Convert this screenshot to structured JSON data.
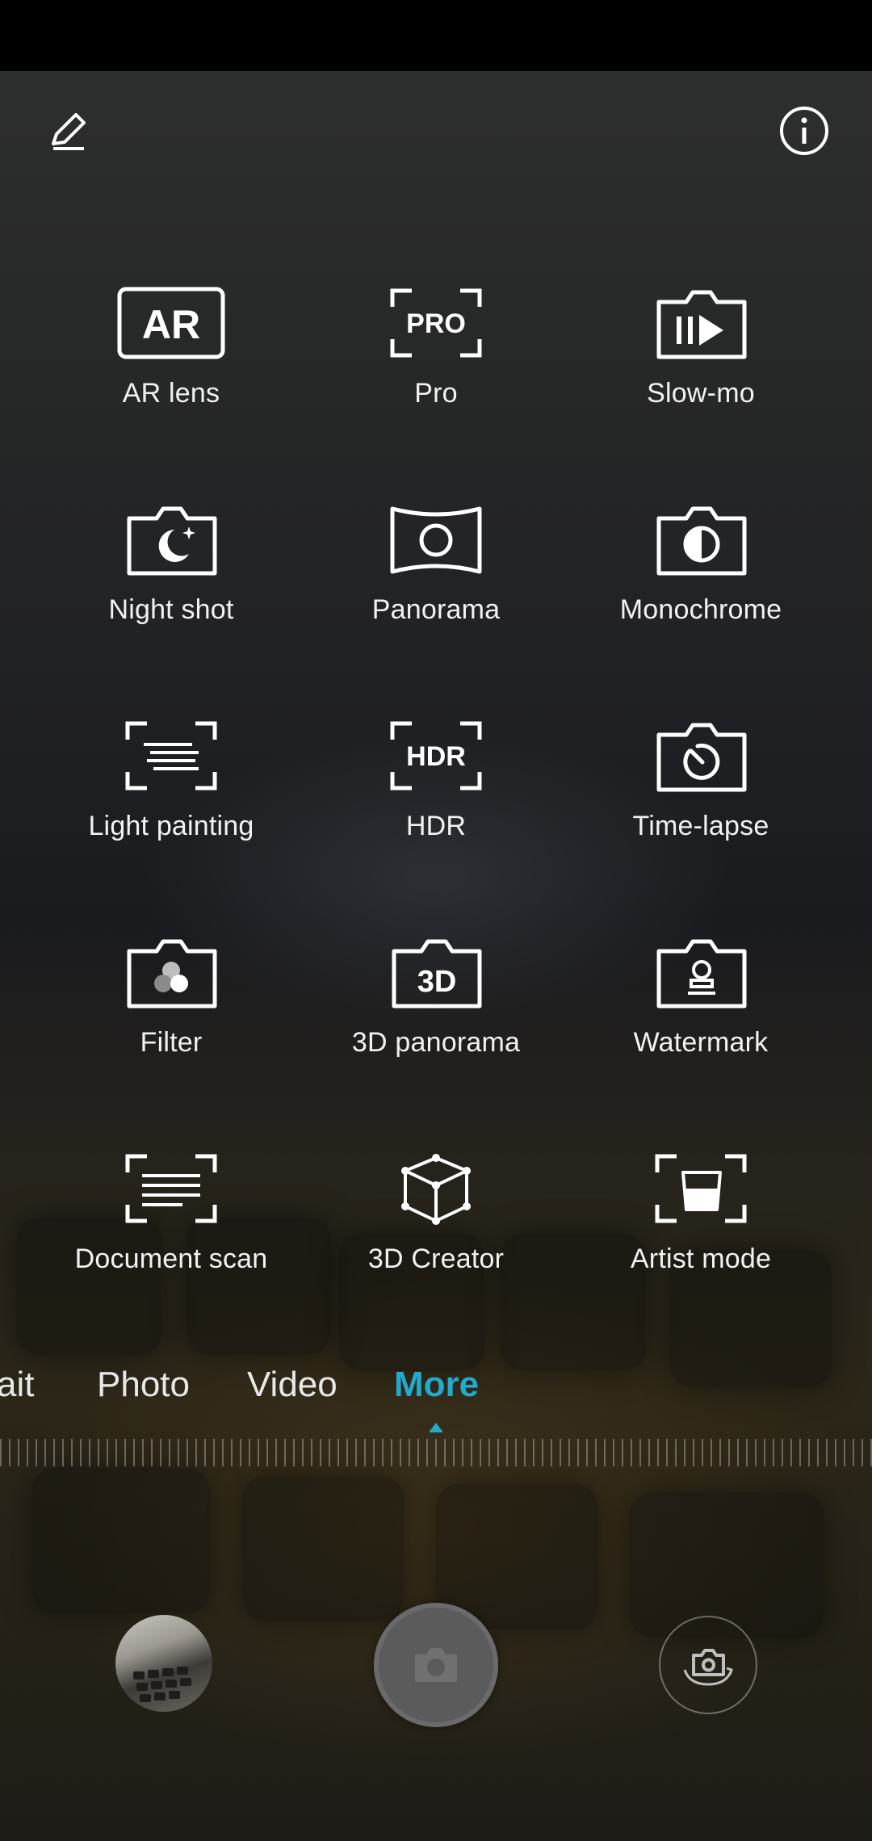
{
  "modes": [
    {
      "label": "AR lens",
      "icon": "ar-lens-icon"
    },
    {
      "label": "Pro",
      "icon": "pro-icon"
    },
    {
      "label": "Slow-mo",
      "icon": "slow-mo-icon"
    },
    {
      "label": "Night shot",
      "icon": "night-shot-icon"
    },
    {
      "label": "Panorama",
      "icon": "panorama-icon"
    },
    {
      "label": "Monochrome",
      "icon": "monochrome-icon"
    },
    {
      "label": "Light painting",
      "icon": "light-painting-icon"
    },
    {
      "label": "HDR",
      "icon": "hdr-icon"
    },
    {
      "label": "Time-lapse",
      "icon": "time-lapse-icon"
    },
    {
      "label": "Filter",
      "icon": "filter-icon"
    },
    {
      "label": "3D panorama",
      "icon": "3d-panorama-icon"
    },
    {
      "label": "Watermark",
      "icon": "watermark-icon"
    },
    {
      "label": "Document scan",
      "icon": "document-scan-icon"
    },
    {
      "label": "3D Creator",
      "icon": "3d-creator-icon"
    },
    {
      "label": "Artist mode",
      "icon": "artist-mode-icon"
    }
  ],
  "mode_tabs": [
    "ait",
    "Photo",
    "Video",
    "More"
  ],
  "active_tab": "More",
  "icon_texts": {
    "ar": "AR",
    "pro": "PRO",
    "hdr": "HDR",
    "three_d": "3D"
  },
  "colors": {
    "accent": "#22aacb",
    "text": "#f2f2f2"
  },
  "top_icons": [
    "edit-icon",
    "info-icon"
  ],
  "bottom_icons": [
    "gallery-thumbnail",
    "camera-icon",
    "switch-camera-icon"
  ]
}
